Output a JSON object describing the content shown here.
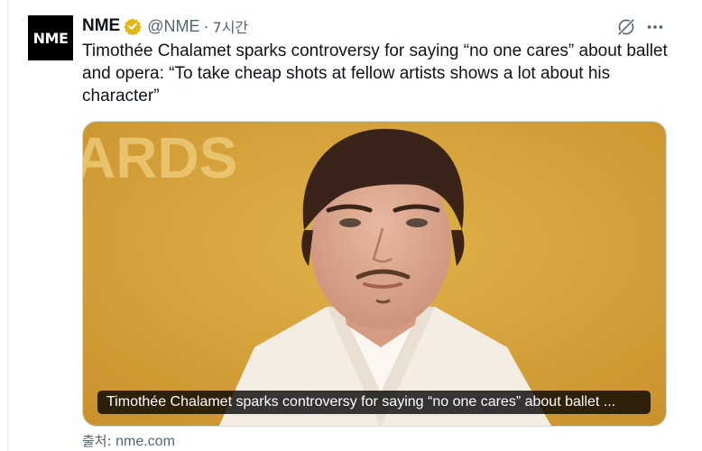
{
  "author": {
    "avatar_text": "NME",
    "name": "NME",
    "verified_badge": "gold-verified-badge",
    "handle": "@NME",
    "separator": "·",
    "time": "7시간"
  },
  "actions": {
    "grok_icon": "grok-icon",
    "more_icon": "more-icon"
  },
  "tweet": {
    "text": "Timothée Chalamet sparks controversy for saying “no one cares” about ballet and opera: “To take cheap shots at fellow artists shows a lot about his character”"
  },
  "media": {
    "background_text": "ARDS",
    "caption": "Timothée Chalamet sparks controversy for saying “no one cares” about ballet ..."
  },
  "source": {
    "label": "출처:",
    "domain": "nme.com"
  },
  "colors": {
    "badge_gold": "#e2b719",
    "secondary_text": "#536471",
    "photo_background": "#d9a532"
  }
}
